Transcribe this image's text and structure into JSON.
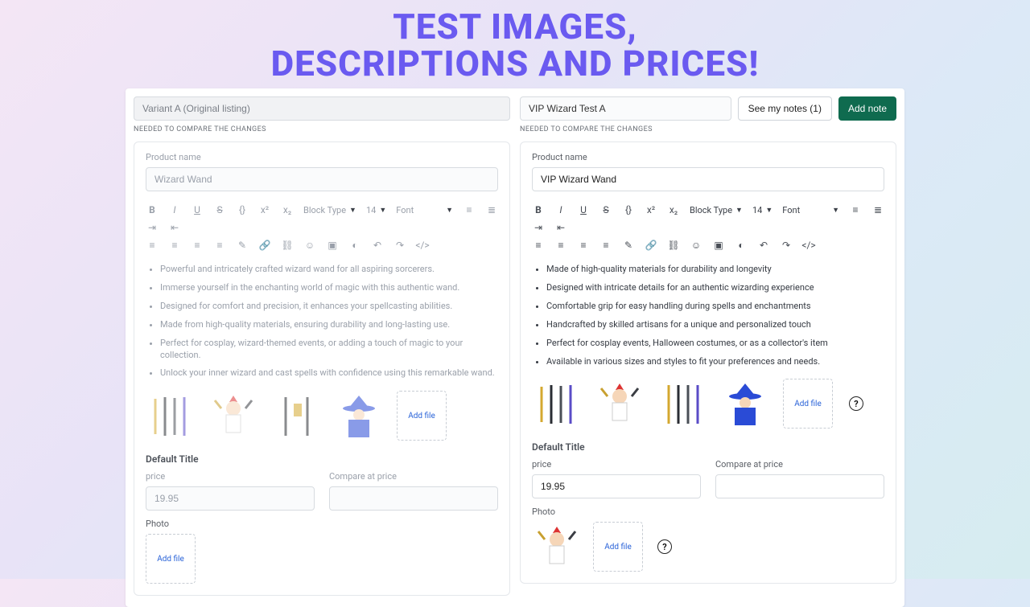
{
  "hero_line1": "TEST IMAGES,",
  "hero_line2": "DESCRIPTIONS AND PRICES!",
  "left": {
    "variant_name": "Variant A (Original listing)",
    "hint": "NEEDED TO COMPARE THE CHANGES",
    "product_name_label": "Product name",
    "product_name": "Wizard Wand",
    "block_type": "Block Type",
    "font_size": "14",
    "font": "Font",
    "bullets": [
      "Powerful and intricately crafted wizard wand for all aspiring sorcerers.",
      "Immerse yourself in the enchanting world of magic with this authentic wand.",
      "Designed for comfort and precision, it enhances your spellcasting abilities.",
      "Made from high-quality materials, ensuring durability and long-lasting use.",
      "Perfect for cosplay, wizard-themed events, or adding a touch of magic to your collection.",
      "Unlock your inner wizard and cast spells with confidence using this remarkable wand."
    ],
    "add_file": "Add file",
    "default_title": "Default Title",
    "price_label": "price",
    "price": "19.95",
    "compare_label": "Compare at price",
    "compare": "",
    "photo_label": "Photo"
  },
  "right": {
    "variant_name": "VIP Wizard Test A",
    "see_notes": "See my notes (1)",
    "add_note": "Add note",
    "hint": "NEEDED TO COMPARE THE CHANGES",
    "product_name_label": "Product name",
    "product_name": "VIP Wizard Wand",
    "block_type": "Block Type",
    "font_size": "14",
    "font": "Font",
    "bullets": [
      "Made of high-quality materials for durability and longevity",
      "Designed with intricate details for an authentic wizarding experience",
      "Comfortable grip for easy handling during spells and enchantments",
      "Handcrafted by skilled artisans for a unique and personalized touch",
      "Perfect for cosplay events, Halloween costumes, or as a collector's item",
      "Available in various sizes and styles to fit your preferences and needs."
    ],
    "add_file": "Add file",
    "default_title": "Default Title",
    "price_label": "price",
    "price": "19.95",
    "compare_label": "Compare at price",
    "compare": "",
    "photo_label": "Photo"
  }
}
